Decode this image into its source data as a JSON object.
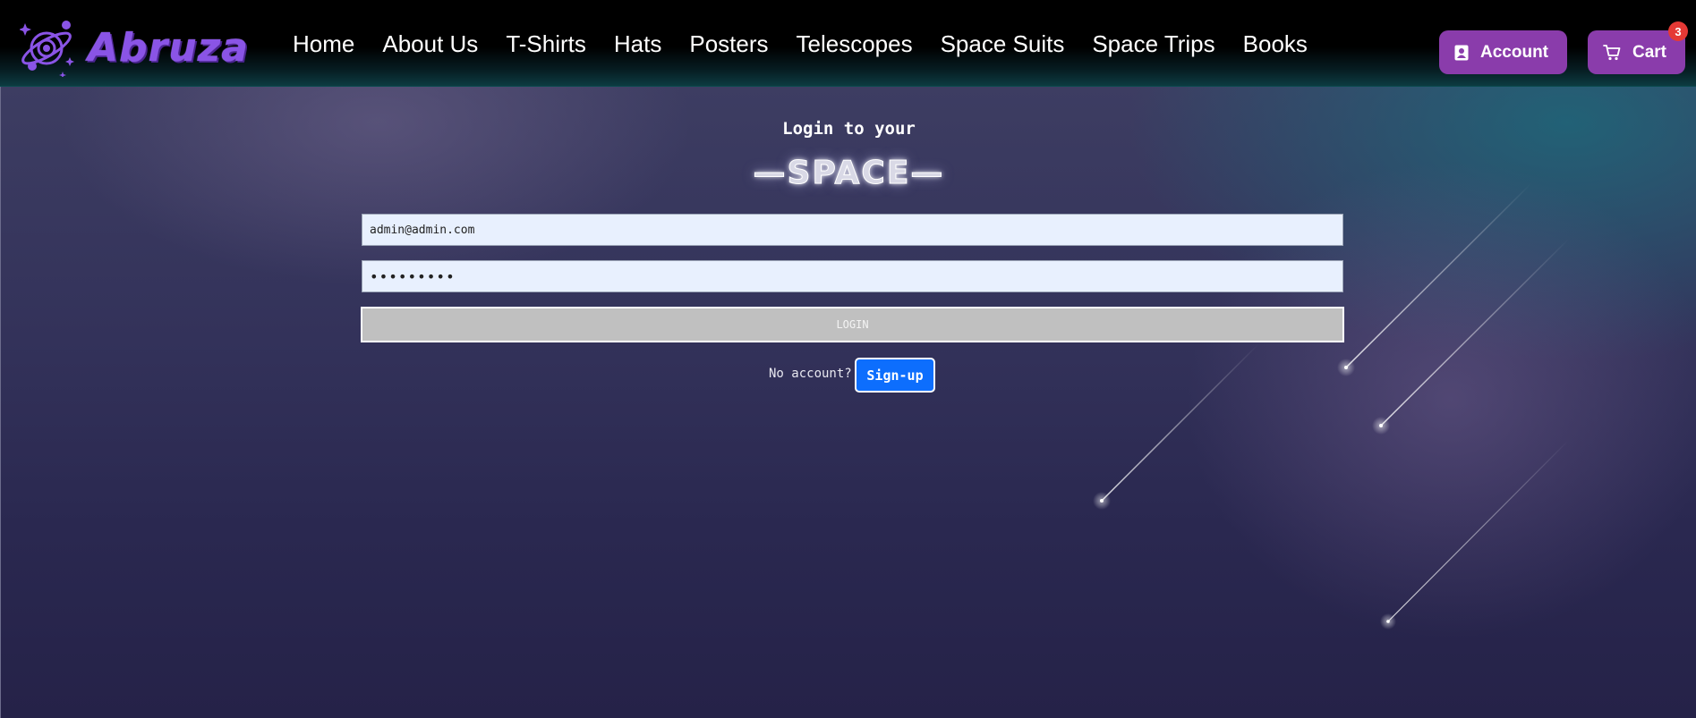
{
  "brand": {
    "name": "Abruza",
    "colors": {
      "brand_purple": "#8a54e6",
      "button_purple": "#8a3cab",
      "badge_red": "#e53935",
      "signup_blue": "#0d6efd"
    }
  },
  "nav": {
    "items": [
      {
        "label": "Home"
      },
      {
        "label": "About Us"
      },
      {
        "label": "T-Shirts"
      },
      {
        "label": "Hats"
      },
      {
        "label": "Posters"
      },
      {
        "label": "Telescopes"
      },
      {
        "label": "Space Suits"
      },
      {
        "label": "Space Trips"
      },
      {
        "label": "Books"
      }
    ]
  },
  "header_actions": {
    "account_label": "Account",
    "account_icon": "user-badge-icon",
    "cart_label": "Cart",
    "cart_icon": "cart-icon",
    "cart_count": "3"
  },
  "login": {
    "heading": "Login to your",
    "title": "—SPACE—",
    "email_value": "admin@admin.com",
    "password_value": "•••••••••",
    "login_button": "LOGIN",
    "no_account_text": "No account?",
    "signup_button": "Sign-up"
  }
}
